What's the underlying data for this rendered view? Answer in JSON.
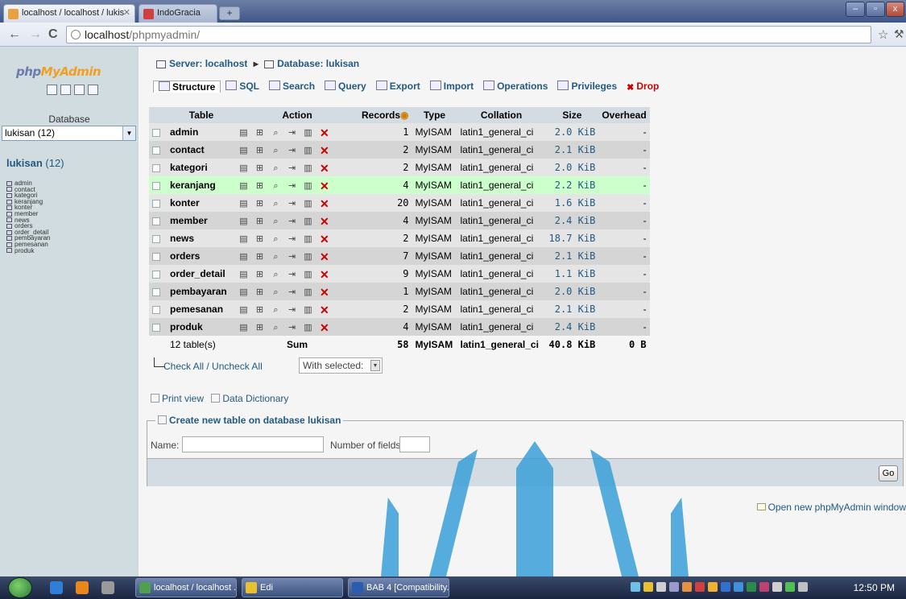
{
  "browser": {
    "tabs": [
      {
        "title": "localhost / localhost / lukis",
        "active": true
      },
      {
        "title": "IndoGracia",
        "active": false
      }
    ],
    "new_tab_label": "+",
    "window_controls": [
      "–",
      "▫",
      "x"
    ],
    "url_host": "localhost",
    "url_path": "/phpmyadmin/"
  },
  "sidebar": {
    "logo_prefix": "php",
    "logo_accent": "MyAdmin",
    "database_label": "Database",
    "database_select": "lukisan (12)",
    "db_link_name": "lukisan",
    "db_link_count": " (12)",
    "tables": [
      "admin",
      "contact",
      "kategori",
      "keranjang",
      "konter",
      "member",
      "news",
      "orders",
      "order_detail",
      "pembayaran",
      "pemesanan",
      "produk"
    ]
  },
  "header": {
    "server": "Server: localhost",
    "separator": "▸",
    "database": "Database: lukisan"
  },
  "tabs": [
    {
      "label": "Structure",
      "icon": "structure-icon"
    },
    {
      "label": "SQL",
      "icon": "sql-icon"
    },
    {
      "label": "Search",
      "icon": "search-icon"
    },
    {
      "label": "Query",
      "icon": "query-icon"
    },
    {
      "label": "Export",
      "icon": "export-icon"
    },
    {
      "label": "Import",
      "icon": "import-icon"
    },
    {
      "label": "Operations",
      "icon": "operations-icon"
    },
    {
      "label": "Privileges",
      "icon": "privileges-icon"
    },
    {
      "label": "Drop",
      "icon": "drop-icon"
    }
  ],
  "table": {
    "headers": [
      "Table",
      "Action",
      "Records",
      "Type",
      "Collation",
      "Size",
      "Overhead"
    ],
    "rows": [
      {
        "name": "admin",
        "records": "1",
        "type": "MyISAM",
        "collation": "latin1_general_ci",
        "size": "2.0 KiB",
        "overhead": "-"
      },
      {
        "name": "contact",
        "records": "2",
        "type": "MyISAM",
        "collation": "latin1_general_ci",
        "size": "2.1 KiB",
        "overhead": "-"
      },
      {
        "name": "kategori",
        "records": "2",
        "type": "MyISAM",
        "collation": "latin1_general_ci",
        "size": "2.0 KiB",
        "overhead": "-"
      },
      {
        "name": "keranjang",
        "records": "4",
        "type": "MyISAM",
        "collation": "latin1_general_ci",
        "size": "2.2 KiB",
        "overhead": "-"
      },
      {
        "name": "konter",
        "records": "20",
        "type": "MyISAM",
        "collation": "latin1_general_ci",
        "size": "1.6 KiB",
        "overhead": "-"
      },
      {
        "name": "member",
        "records": "4",
        "type": "MyISAM",
        "collation": "latin1_general_ci",
        "size": "2.4 KiB",
        "overhead": "-"
      },
      {
        "name": "news",
        "records": "2",
        "type": "MyISAM",
        "collation": "latin1_general_ci",
        "size": "18.7 KiB",
        "overhead": "-"
      },
      {
        "name": "orders",
        "records": "7",
        "type": "MyISAM",
        "collation": "latin1_general_ci",
        "size": "2.1 KiB",
        "overhead": "-"
      },
      {
        "name": "order_detail",
        "records": "9",
        "type": "MyISAM",
        "collation": "latin1_general_ci",
        "size": "1.1 KiB",
        "overhead": "-"
      },
      {
        "name": "pembayaran",
        "records": "1",
        "type": "MyISAM",
        "collation": "latin1_general_ci",
        "size": "2.0 KiB",
        "overhead": "-"
      },
      {
        "name": "pemesanan",
        "records": "2",
        "type": "MyISAM",
        "collation": "latin1_general_ci",
        "size": "2.1 KiB",
        "overhead": "-"
      },
      {
        "name": "produk",
        "records": "4",
        "type": "MyISAM",
        "collation": "latin1_general_ci",
        "size": "2.4 KiB",
        "overhead": "-"
      }
    ],
    "highlighted_row": "keranjang",
    "footer": {
      "count": "12 table(s)",
      "sum_label": "Sum",
      "records": "58",
      "type": "MyISAM",
      "collation": "latin1_general_ci",
      "size": "40.8 KiB",
      "overhead": "0 B"
    }
  },
  "bulk": {
    "check_all": "Check All",
    "slash": " / ",
    "uncheck_all": "Uncheck All",
    "with_selected": "With selected:"
  },
  "links": {
    "print_view": "Print view",
    "data_dictionary": "Data Dictionary"
  },
  "create": {
    "legend": "Create new table on database lukisan",
    "name_label": "Name:",
    "name_value": "",
    "fields_label": "Number of fields:",
    "fields_value": "",
    "go_label": "Go"
  },
  "new_window_link": "Open new phpMyAdmin window",
  "taskbar": {
    "buttons": [
      "localhost / localhost ...",
      "Edi",
      "BAB 4 [Compatibility..."
    ],
    "clock": "12:50 PM"
  }
}
